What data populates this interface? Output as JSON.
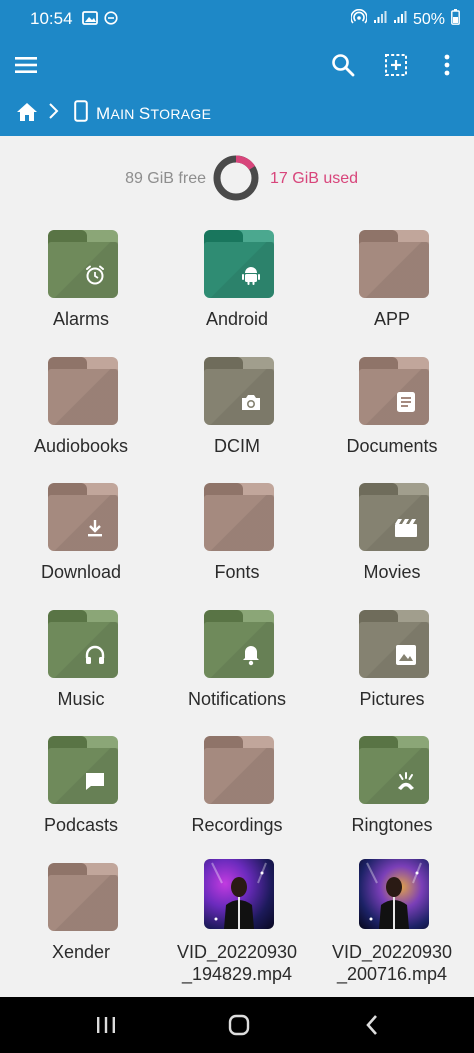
{
  "status_bar": {
    "time": "10:54",
    "battery": "50%"
  },
  "toolbar": {
    "menu_icon": "menu-icon",
    "search_icon": "search-icon",
    "select_icon": "select-add-icon",
    "more_icon": "more-vert-icon"
  },
  "breadcrumb": {
    "home_icon": "home-icon",
    "storage_label_first": "M",
    "storage_label_rest1": "AIN ",
    "storage_label_s": "S",
    "storage_label_rest2": "TORAGE"
  },
  "storage": {
    "free": "89 GiB free",
    "used": "17 GiB used",
    "used_fraction": 0.16
  },
  "colors": {
    "accent": "#1e88c7",
    "used": "#d8457b",
    "green": "#6f8a5b",
    "teal": "#2f8c73",
    "brown": "#a58a7f",
    "olive": "#858271"
  },
  "items": [
    {
      "label": "Alarms",
      "color": "green",
      "icon": "alarm-icon"
    },
    {
      "label": "Android",
      "color": "teal",
      "icon": "android-icon"
    },
    {
      "label": "APP",
      "color": "brown",
      "icon": ""
    },
    {
      "label": "Audiobooks",
      "color": "brown",
      "icon": ""
    },
    {
      "label": "DCIM",
      "color": "olive",
      "icon": "camera-icon"
    },
    {
      "label": "Documents",
      "color": "brown",
      "icon": "document-icon"
    },
    {
      "label": "Download",
      "color": "brown",
      "icon": "download-icon"
    },
    {
      "label": "Fonts",
      "color": "brown",
      "icon": ""
    },
    {
      "label": "Movies",
      "color": "olive",
      "icon": "clapperboard-icon"
    },
    {
      "label": "Music",
      "color": "green",
      "icon": "headphones-icon"
    },
    {
      "label": "Notifications",
      "color": "green",
      "icon": "bell-icon"
    },
    {
      "label": "Pictures",
      "color": "olive",
      "icon": "image-icon"
    },
    {
      "label": "Podcasts",
      "color": "green",
      "icon": "chat-icon"
    },
    {
      "label": "Recordings",
      "color": "brown",
      "icon": ""
    },
    {
      "label": "Ringtones",
      "color": "green",
      "icon": "ringtone-icon"
    },
    {
      "label": "Xender",
      "color": "brown",
      "icon": ""
    },
    {
      "label": "VID_20220930\n_194829.mp4",
      "color": "video",
      "icon": "video-thumbnail"
    },
    {
      "label": "VID_20220930\n_200716.mp4",
      "color": "video",
      "icon": "video-thumbnail"
    }
  ],
  "nav": {
    "recents_icon": "recents-icon",
    "home_icon": "home-circle-icon",
    "back_icon": "back-icon"
  }
}
